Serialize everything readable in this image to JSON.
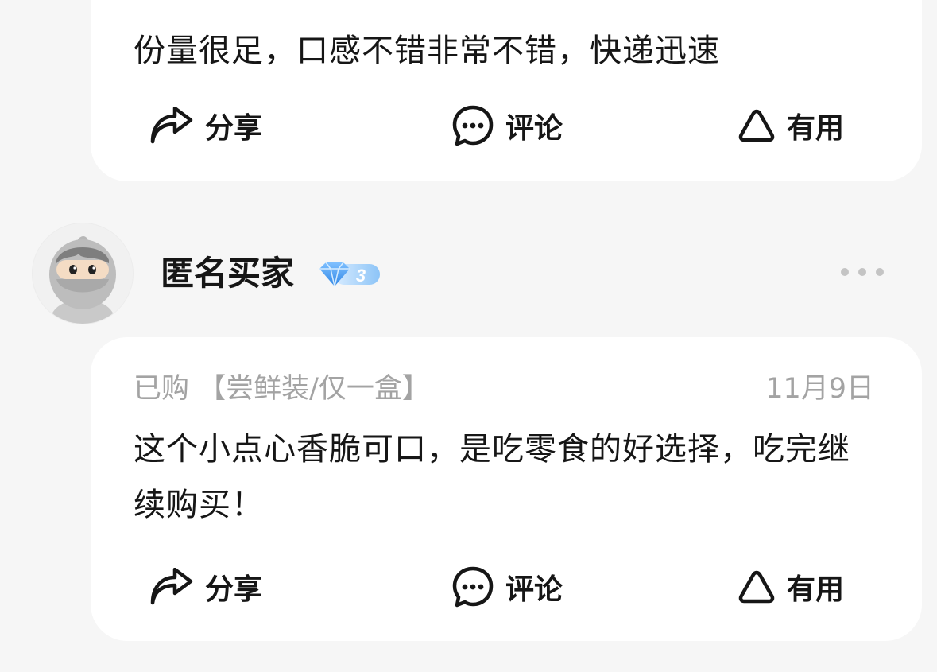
{
  "reviews": [
    {
      "text": "份量很足，口感不错非常不错，快递迅速",
      "actions": {
        "share_label": "分享",
        "comment_label": "评论",
        "useful_label": "有用"
      }
    },
    {
      "user": {
        "name": "匿名买家",
        "level": "3"
      },
      "purchased_label": "已购 【尝鲜装/仅一盒】",
      "date": "11月9日",
      "text": "这个小点心香脆可口，是吃零食的好选择，吃完继续购买！",
      "actions": {
        "share_label": "分享",
        "comment_label": "评论",
        "useful_label": "有用"
      }
    }
  ],
  "icons": {
    "share": "share-arrow-icon",
    "comment": "comment-bubble-icon",
    "useful": "triangle-useful-icon",
    "more": "more-dots-icon",
    "level": "diamond-icon",
    "avatar": "ninja-avatar"
  },
  "colors": {
    "background": "#f6f6f6",
    "card": "#ffffff",
    "text": "#161616",
    "muted": "#a3a3a3",
    "badge": "#5aa8f5"
  }
}
